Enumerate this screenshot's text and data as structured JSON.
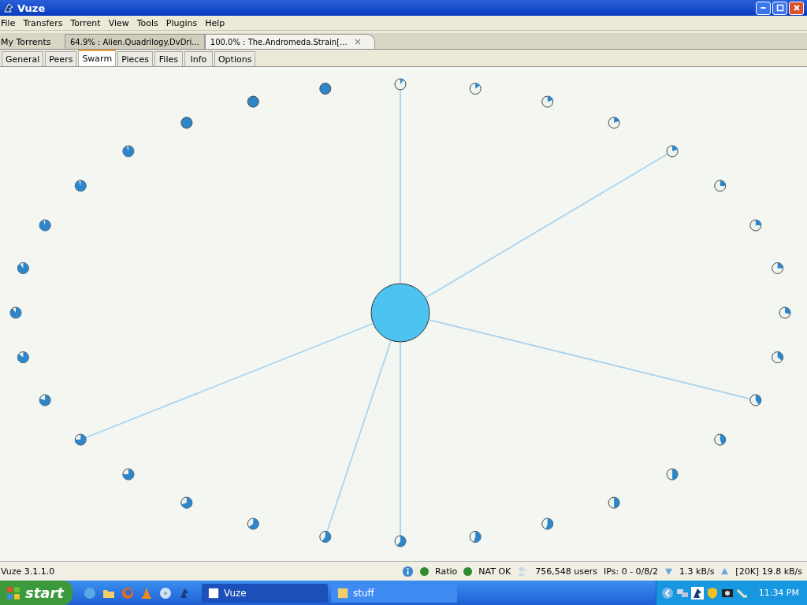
{
  "window": {
    "title": "Vuze"
  },
  "menu": [
    "File",
    "Transfers",
    "Torrent",
    "View",
    "Tools",
    "Plugins",
    "Help"
  ],
  "torrent_tabs": {
    "label": "My Torrents",
    "tabs": [
      {
        "label": "64.9% : Alien.Quadrilogy.DvDri...",
        "selected": false
      },
      {
        "label": "100.0% : The.Andromeda.Strain[...",
        "selected": true
      }
    ]
  },
  "view_tabs": [
    {
      "label": "General",
      "selected": false
    },
    {
      "label": "Peers",
      "selected": false
    },
    {
      "label": "Swarm",
      "selected": true
    },
    {
      "label": "Pieces",
      "selected": false
    },
    {
      "label": "Files",
      "selected": false
    },
    {
      "label": "Info",
      "selected": false
    },
    {
      "label": "Options",
      "selected": false
    }
  ],
  "peers": [
    {
      "connected": true
    },
    {
      "connected": false
    },
    {
      "connected": false
    },
    {
      "connected": false
    },
    {
      "connected": true
    },
    {
      "connected": false
    },
    {
      "connected": false
    },
    {
      "connected": false
    },
    {
      "connected": false
    },
    {
      "connected": false
    },
    {
      "connected": true
    },
    {
      "connected": false
    },
    {
      "connected": false
    },
    {
      "connected": false
    },
    {
      "connected": false
    },
    {
      "connected": false
    },
    {
      "connected": true
    },
    {
      "connected": true
    },
    {
      "connected": false
    },
    {
      "connected": false
    },
    {
      "connected": false
    },
    {
      "connected": true
    },
    {
      "connected": false
    },
    {
      "connected": false
    },
    {
      "connected": false
    },
    {
      "connected": false
    },
    {
      "connected": false
    },
    {
      "connected": false
    },
    {
      "connected": false
    },
    {
      "connected": false
    },
    {
      "connected": false
    },
    {
      "connected": false
    }
  ],
  "status_bar": {
    "version": "Vuze 3.1.1.0",
    "indicators": [
      {
        "label": "Ratio",
        "color": "#2e8b2e"
      },
      {
        "label": "NAT OK",
        "color": "#2e8b2e"
      }
    ],
    "users": "756,548 users",
    "ips": "IPs: 0 - 0/8/2",
    "download": "1.3 kB/s",
    "upload": "[20K] 19.8 kB/s"
  },
  "taskbar": {
    "start": "start",
    "tasks": [
      {
        "label": "Vuze",
        "selected": true
      },
      {
        "label": "stuff",
        "selected": false
      }
    ],
    "clock": "11:34 PM"
  }
}
